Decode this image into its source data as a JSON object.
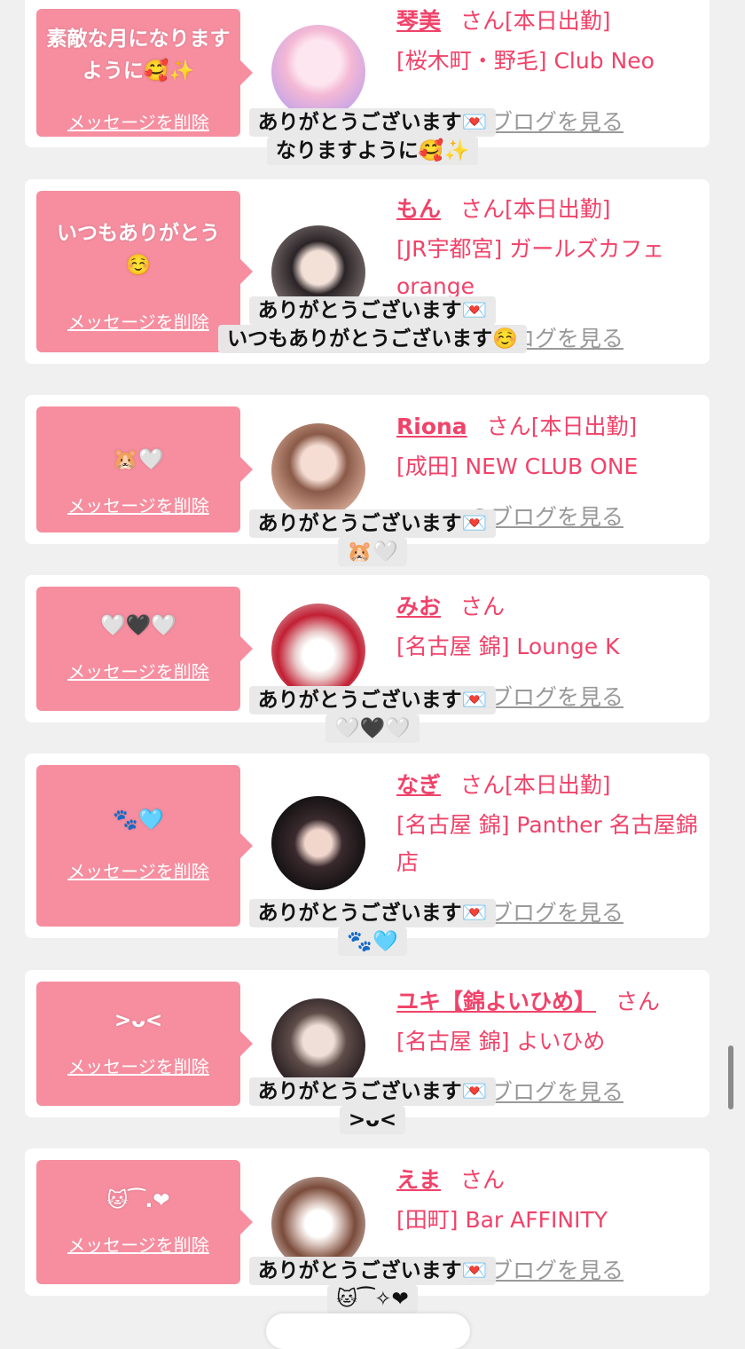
{
  "colors": {
    "accent": "#f0436a",
    "bubble": "#f68ea0",
    "card": "#ffffff",
    "page_bg": "#f0f0f0",
    "link_gray": "#999999"
  },
  "delete_label": "メッセージを削除",
  "san_label": "さん",
  "blog_label": "のブログを見る",
  "entries": [
    {
      "message": "素敵な月になりますように🥰✨",
      "name": "琴美",
      "status": "[本日出勤]",
      "shop": "[桜木町・野毛] Club Neo",
      "caption_line1": "ありがとうございます💌",
      "caption_line2": "なりますように🥰✨"
    },
    {
      "message": "いつもありがとう☺️",
      "name": "もん",
      "status": "[本日出勤]",
      "shop": "[JR宇都宮] ガールズカフェ orange",
      "caption_line1": "ありがとうございます💌",
      "caption_line2": "いつもありがとうございます☺️"
    },
    {
      "message": "🐹🤍",
      "name": "Riona",
      "status": "[本日出勤]",
      "shop": "[成田] NEW CLUB ONE",
      "caption_line1": "ありがとうございます💌",
      "caption_line2": "🐹🤍"
    },
    {
      "message": "🤍🖤🤍",
      "name": "みお",
      "status": "",
      "shop": "[名古屋 錦] Lounge K",
      "caption_line1": "ありがとうございます💌",
      "caption_line2": "🤍🖤🤍"
    },
    {
      "message": "🐾🩵",
      "name": "なぎ",
      "status": "[本日出勤]",
      "shop": "[名古屋 錦] Panther 名古屋錦店",
      "caption_line1": "ありがとうございます💌",
      "caption_line2": "🐾🩵"
    },
    {
      "message": ">ᴗ<",
      "name": "ユキ【錦よいひめ】",
      "status": "",
      "shop": "[名古屋 錦] よいひめ",
      "caption_line1": "ありがとうございます💌",
      "caption_line2": ">ᴗ<"
    },
    {
      "message": "🐱⁀.❤︎",
      "name": "えま",
      "status": "",
      "shop": "[田町] Bar AFFINITY",
      "caption_line1": "ありがとうございます💌",
      "caption_line2": "🐱⁀✧❤"
    }
  ]
}
